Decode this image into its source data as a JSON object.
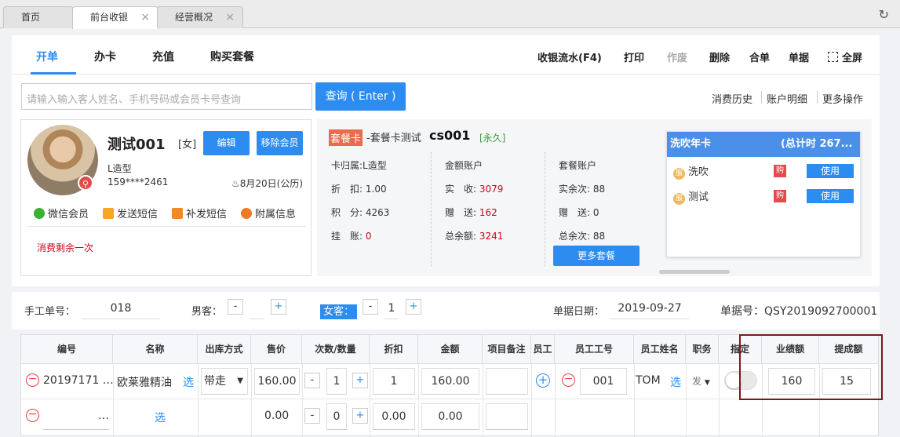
{
  "window_tabs": [
    {
      "label": "首页"
    },
    {
      "label": "前台收银"
    },
    {
      "label": "经营概况"
    }
  ],
  "nav": {
    "tabs": [
      "开单",
      "办卡",
      "充值",
      "购买套餐"
    ],
    "actions": [
      "收银流水(F4)",
      "打印",
      "作废",
      "删除",
      "合单",
      "单据",
      "全屏"
    ]
  },
  "search": {
    "placeholder": "请输入输入客人姓名、手机号码或会员卡号查询",
    "button": "查询 ( Enter )",
    "links": [
      "消费历史",
      "账户明细",
      "更多操作"
    ]
  },
  "member": {
    "name": "测试001",
    "gender": "[女]",
    "edit": "编辑",
    "remove": "移除会员",
    "store": "L造型",
    "phone": "159****2461",
    "birthday": "8月20日(公历)",
    "actions": [
      "微信会员",
      "发送短信",
      "补发短信",
      "附属信息"
    ],
    "note": "消费剩余一次"
  },
  "card": {
    "tag": "套餐卡",
    "name": "-套餐卡测试",
    "code": "cs001",
    "validity": "[永久]",
    "col1": {
      "belong_label": "卡归属:",
      "belong": "L造型",
      "discount_label": "折　扣:",
      "discount": "1.00",
      "points_label": "积　分:",
      "points": "4263",
      "credit_label": "挂　账:",
      "credit": "0"
    },
    "col2": {
      "title": "金额账户",
      "received_label": "实　收:",
      "received": "3079",
      "gift_label": "赠　送:",
      "gift": "162",
      "balance_label": "总余额:",
      "balance": "3241"
    },
    "col3": {
      "title": "套餐账户",
      "actual_label": "实余次:",
      "actual": "88",
      "gift_label": "赠　送:",
      "gift": "0",
      "total_label": "总余次:",
      "total": "88"
    },
    "more": "更多套餐"
  },
  "yearcard": {
    "title": "洗吹年卡",
    "total": "(总计时 267...",
    "services": [
      {
        "name": "洗吹",
        "buy": "购",
        "use": "使用"
      },
      {
        "name": "测试",
        "buy": "购",
        "use": "使用"
      }
    ]
  },
  "order": {
    "manual_label": "手工单号：",
    "manual": "018",
    "male_label": "男客：",
    "male": "",
    "female_label": "女客：",
    "female": "1",
    "date_label": "单据日期：",
    "date": "2019-09-27",
    "no_label": "单据号：",
    "no": "QSY2019092700001"
  },
  "table": {
    "headers": [
      "编号",
      "名称",
      "出库方式",
      "售价",
      "次数/数量",
      "折扣",
      "金额",
      "项目备注",
      "员工",
      "员工工号",
      "员工姓名",
      "职务",
      "指定",
      "业绩额",
      "提成额"
    ],
    "rows": [
      {
        "code": "20197171 …",
        "name": "欧莱雅精油",
        "select": "选",
        "out": "带走",
        "price": "160.00",
        "qty": "1",
        "discount": "1",
        "amount": "160.00",
        "emp_no": "001",
        "emp_name": "TOM",
        "emp_select": "选",
        "role": "发",
        "perf": "160",
        "comm": "15"
      },
      {
        "code": "…",
        "name": "",
        "select": "选",
        "price": "0.00",
        "qty": "0",
        "discount": "0.00",
        "amount": "0.00"
      }
    ]
  }
}
